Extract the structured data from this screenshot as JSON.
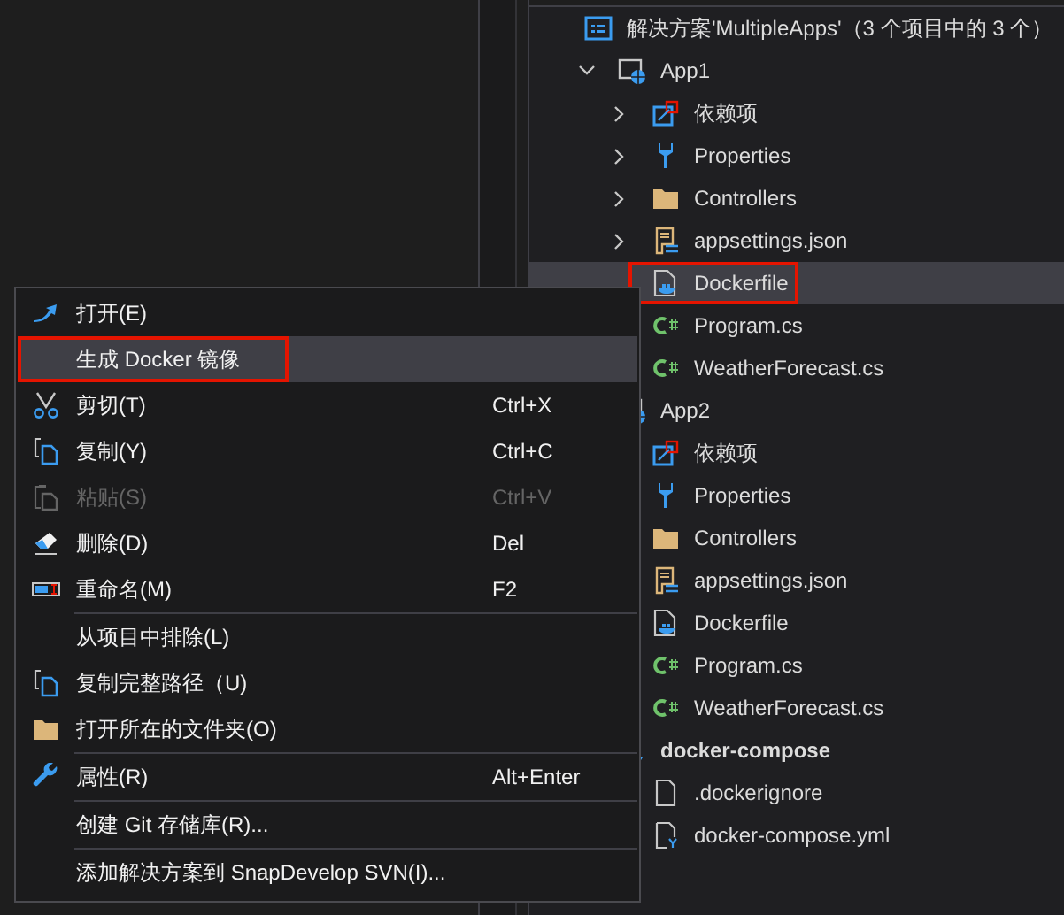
{
  "solution_explorer": {
    "tree": [
      {
        "label": "解决方案'MultipleApps'（3 个项目中的 3 个）",
        "kind": "solution",
        "selected": false,
        "annotated": false,
        "children": [
          {
            "label": "App1",
            "kind": "web-project",
            "expanded": true,
            "selected": false,
            "annotated": false,
            "children": [
              {
                "label": "依赖项",
                "kind": "dependencies",
                "expanded": false,
                "selected": false,
                "annotated": false
              },
              {
                "label": "Properties",
                "kind": "properties",
                "expanded": false,
                "selected": false,
                "annotated": false
              },
              {
                "label": "Controllers",
                "kind": "folder",
                "expanded": false,
                "selected": false,
                "annotated": false
              },
              {
                "label": "appsettings.json",
                "kind": "json",
                "expanded": false,
                "selected": false,
                "annotated": false
              },
              {
                "label": "Dockerfile",
                "kind": "dockerfile",
                "selected": true,
                "annotated": true
              },
              {
                "label": "Program.cs",
                "kind": "csharp",
                "selected": false,
                "annotated": false
              },
              {
                "label": "WeatherForecast.cs",
                "kind": "csharp",
                "selected": false,
                "annotated": false
              }
            ]
          },
          {
            "label": "App2",
            "kind": "web-project",
            "selected": false,
            "annotated": false,
            "children": [
              {
                "label": "依赖项",
                "kind": "dependencies",
                "selected": false,
                "annotated": false
              },
              {
                "label": "Properties",
                "kind": "properties",
                "selected": false,
                "annotated": false
              },
              {
                "label": "Controllers",
                "kind": "folder",
                "selected": false,
                "annotated": false
              },
              {
                "label": "appsettings.json",
                "kind": "json",
                "selected": false,
                "annotated": false
              },
              {
                "label": "Dockerfile",
                "kind": "dockerfile",
                "selected": false,
                "annotated": false
              },
              {
                "label": "Program.cs",
                "kind": "csharp",
                "selected": false,
                "annotated": false
              },
              {
                "label": "WeatherForecast.cs",
                "kind": "csharp",
                "selected": false,
                "annotated": false
              }
            ]
          },
          {
            "label": "docker-compose",
            "kind": "compose-project",
            "selected": false,
            "annotated": false,
            "children": [
              {
                "label": ".dockerignore",
                "kind": "file",
                "selected": false,
                "annotated": false
              },
              {
                "label": "docker-compose.yml",
                "kind": "yaml",
                "selected": false,
                "annotated": false
              }
            ]
          }
        ]
      }
    ]
  },
  "context_menu": {
    "items": [
      {
        "kind": "open",
        "label": "打开(E)",
        "disabled": false,
        "selected": false,
        "annotated": false
      },
      {
        "kind": "plain",
        "label": "生成 Docker 镜像",
        "disabled": false,
        "selected": true,
        "annotated": true
      },
      {
        "kind": "cut",
        "label": "剪切(T)",
        "shortcut": "Ctrl+X",
        "disabled": false,
        "selected": false,
        "annotated": false
      },
      {
        "kind": "copy",
        "label": "复制(Y)",
        "shortcut": "Ctrl+C",
        "disabled": false,
        "selected": false,
        "annotated": false
      },
      {
        "kind": "paste",
        "label": "粘贴(S)",
        "shortcut": "Ctrl+V",
        "disabled": true,
        "selected": false,
        "annotated": false
      },
      {
        "kind": "delete",
        "label": "删除(D)",
        "shortcut": "Del",
        "disabled": false,
        "selected": false,
        "annotated": false
      },
      {
        "kind": "rename",
        "label": "重命名(M)",
        "shortcut": "F2",
        "disabled": false,
        "selected": false,
        "annotated": false
      },
      {
        "kind": "separator"
      },
      {
        "kind": "plain",
        "label": "从项目中排除(L)",
        "disabled": false,
        "selected": false,
        "annotated": false
      },
      {
        "kind": "copy",
        "label": "复制完整路径（U)",
        "disabled": false,
        "selected": false,
        "annotated": false
      },
      {
        "kind": "folder",
        "label": "打开所在的文件夹(O)",
        "disabled": false,
        "selected": false,
        "annotated": false
      },
      {
        "kind": "separator"
      },
      {
        "kind": "properties",
        "label": "属性(R)",
        "shortcut": "Alt+Enter",
        "disabled": false,
        "selected": false,
        "annotated": false
      },
      {
        "kind": "separator"
      },
      {
        "kind": "plain",
        "label": "创建 Git 存储库(R)...",
        "disabled": false,
        "selected": false,
        "annotated": false
      },
      {
        "kind": "separator"
      },
      {
        "kind": "plain",
        "label": "添加解决方案到 SnapDevelop SVN(I)...",
        "disabled": false,
        "selected": false,
        "annotated": false
      }
    ]
  }
}
